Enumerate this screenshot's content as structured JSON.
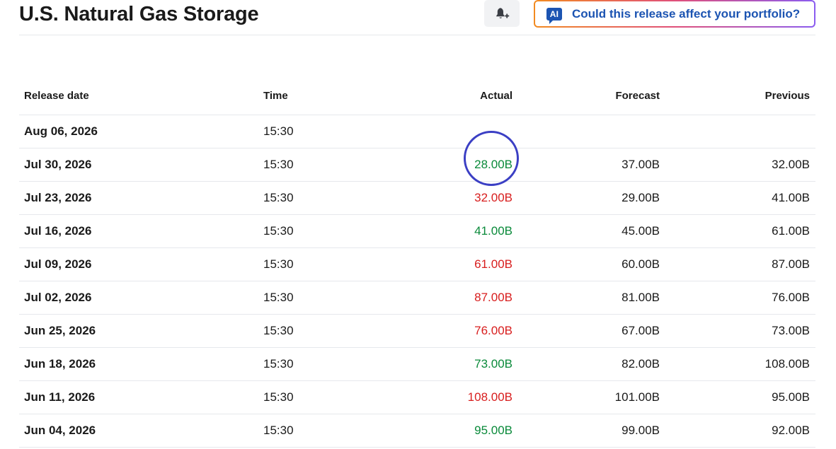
{
  "header": {
    "title": "U.S. Natural Gas Storage",
    "alert_icon": "bell-plus-icon",
    "ai_badge": "AI",
    "ai_prompt": "Could this release affect your portfolio?"
  },
  "table": {
    "columns": [
      "Release date",
      "Time",
      "Actual",
      "Forecast",
      "Previous"
    ],
    "rows": [
      {
        "date": "Aug 06, 2026",
        "time": "15:30",
        "actual": "",
        "actual_trend": "",
        "forecast": "",
        "previous": ""
      },
      {
        "date": "Jul 30, 2026",
        "time": "15:30",
        "actual": "28.00B",
        "actual_trend": "up",
        "forecast": "37.00B",
        "previous": "32.00B"
      },
      {
        "date": "Jul 23, 2026",
        "time": "15:30",
        "actual": "32.00B",
        "actual_trend": "down",
        "forecast": "29.00B",
        "previous": "41.00B"
      },
      {
        "date": "Jul 16, 2026",
        "time": "15:30",
        "actual": "41.00B",
        "actual_trend": "up",
        "forecast": "45.00B",
        "previous": "61.00B"
      },
      {
        "date": "Jul 09, 2026",
        "time": "15:30",
        "actual": "61.00B",
        "actual_trend": "down",
        "forecast": "60.00B",
        "previous": "87.00B"
      },
      {
        "date": "Jul 02, 2026",
        "time": "15:30",
        "actual": "87.00B",
        "actual_trend": "down",
        "forecast": "81.00B",
        "previous": "76.00B"
      },
      {
        "date": "Jun 25, 2026",
        "time": "15:30",
        "actual": "76.00B",
        "actual_trend": "down",
        "forecast": "67.00B",
        "previous": "73.00B"
      },
      {
        "date": "Jun 18, 2026",
        "time": "15:30",
        "actual": "73.00B",
        "actual_trend": "up",
        "forecast": "82.00B",
        "previous": "108.00B"
      },
      {
        "date": "Jun 11, 2026",
        "time": "15:30",
        "actual": "108.00B",
        "actual_trend": "down",
        "forecast": "101.00B",
        "previous": "95.00B"
      },
      {
        "date": "Jun 04, 2026",
        "time": "15:30",
        "actual": "95.00B",
        "actual_trend": "up",
        "forecast": "99.00B",
        "previous": "92.00B"
      }
    ]
  },
  "colors": {
    "up": "#0a8a3a",
    "down": "#d81e1e",
    "brand_blue": "#1c54b2",
    "annotation_circle": "#3b3fc4"
  }
}
